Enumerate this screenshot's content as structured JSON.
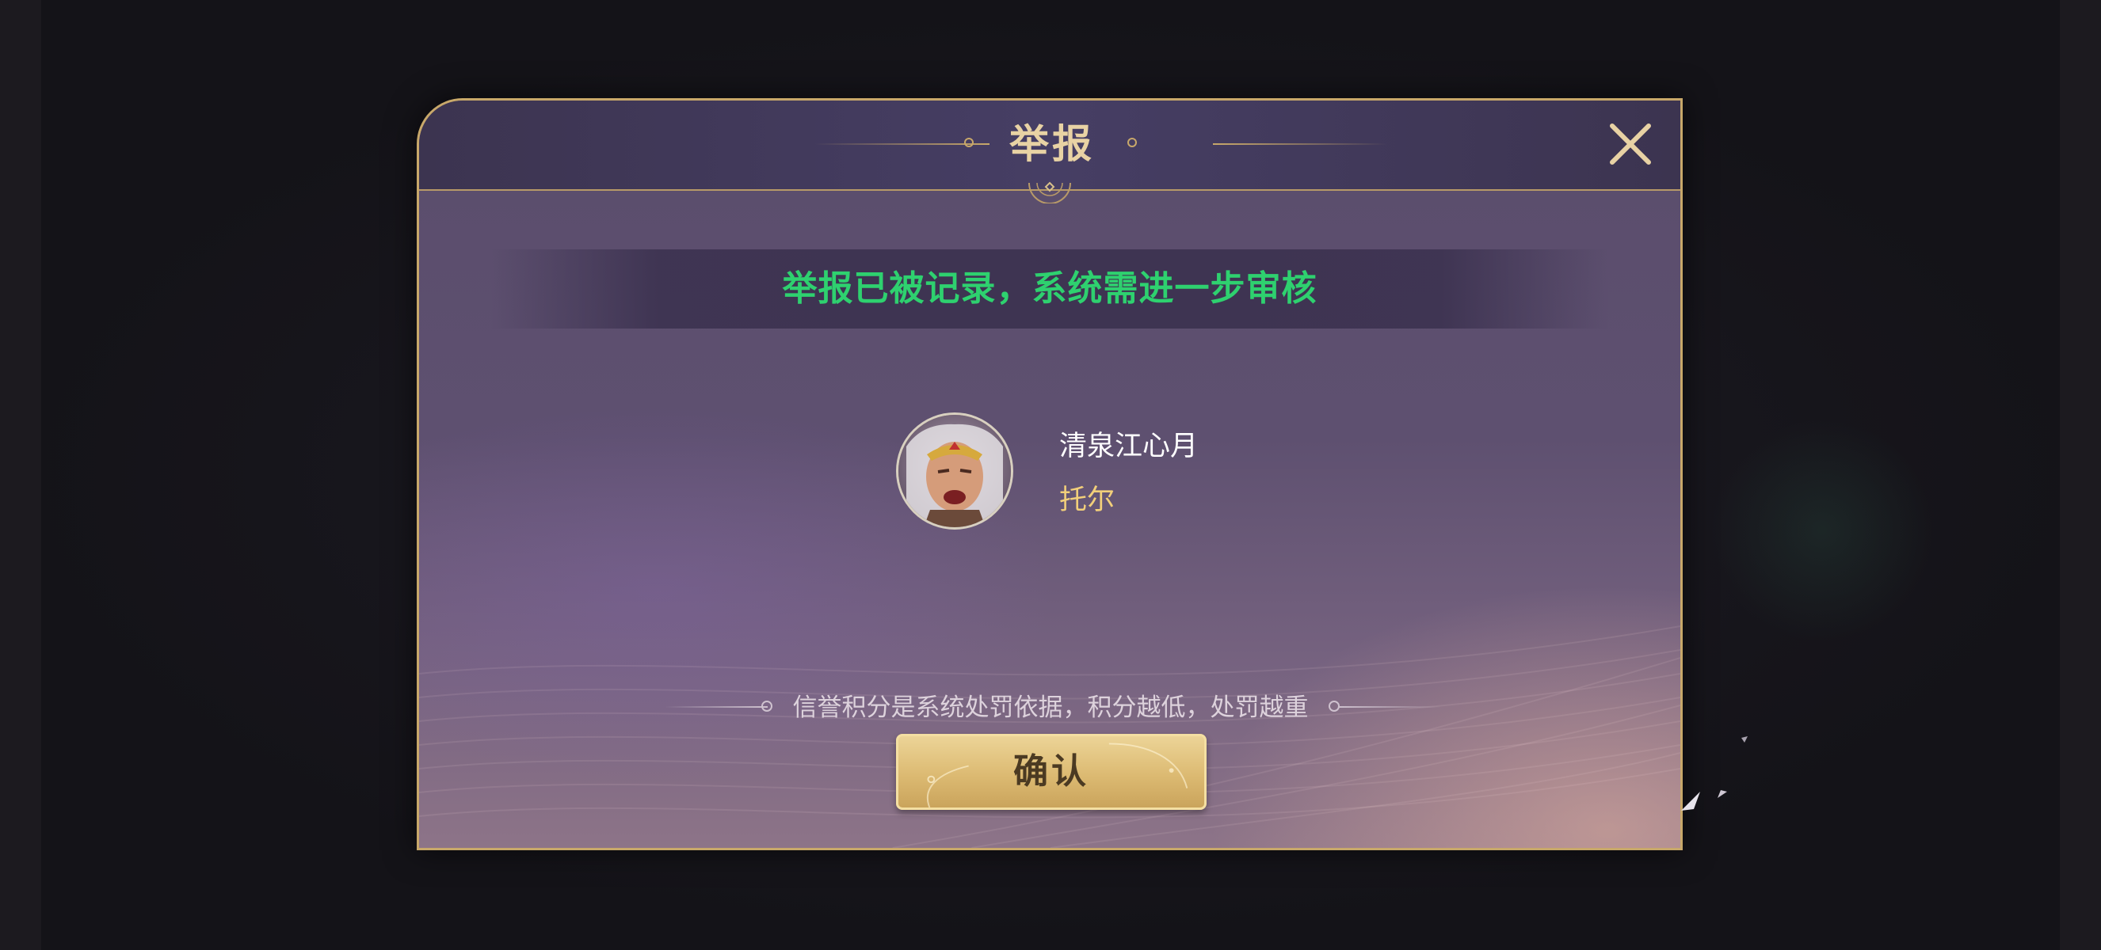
{
  "dialog": {
    "title": "举报",
    "close_icon": "close-icon",
    "status_message": "举报已被记录，系统需进一步审核",
    "reported_player": {
      "name": "清泉江心月",
      "hero": "托尔",
      "avatar_icon": "hero-portrait-avatar"
    },
    "notice": "信誉积分是系统处罚依据，积分越低，处罚越重",
    "confirm_label": "确认"
  },
  "colors": {
    "status_green": "#2ed16f",
    "gold_border": "#c8a86a",
    "hero_name_gold": "#f2cf7a",
    "title_text": "#e8d2a4",
    "button_gold": "#dcba72"
  }
}
